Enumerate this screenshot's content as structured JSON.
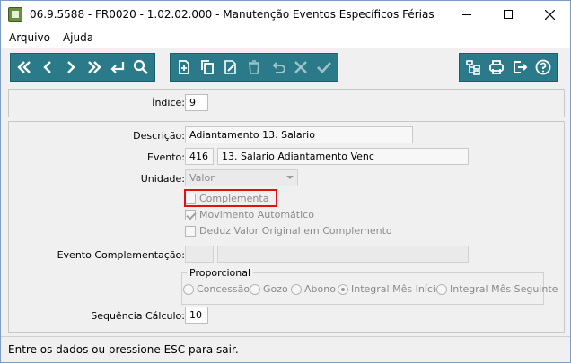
{
  "window": {
    "title": "06.9.5588 - FR0020 - 1.02.02.000 - Manutenção Eventos Específicos Férias"
  },
  "menubar": {
    "items": [
      "Arquivo",
      "Ajuda"
    ]
  },
  "toolbar": {
    "nav": [
      "first-icon",
      "prev-icon",
      "next-icon",
      "last-icon",
      "return-icon",
      "search-icon"
    ],
    "edit": [
      "new-icon",
      "copy-icon",
      "edit-icon",
      "delete-icon",
      "undo-icon",
      "cancel-icon",
      "confirm-icon"
    ],
    "util": [
      "tree-icon",
      "print-icon",
      "exit-icon",
      "help-icon"
    ]
  },
  "index": {
    "label": "Índice:",
    "value": "9"
  },
  "form": {
    "descricao": {
      "label": "Descrição:",
      "value": "Adiantamento 13. Salario"
    },
    "evento": {
      "label": "Evento:",
      "code": "416",
      "description": "13. Salario Adiantamento Venc"
    },
    "unidade": {
      "label": "Unidade:",
      "value": "Valor"
    },
    "complementa": {
      "label": "Complementa",
      "checked": false
    },
    "movimento": {
      "label": "Movimento Automático",
      "checked": true
    },
    "deduz": {
      "label": "Deduz Valor Original em Complemento",
      "checked": false
    },
    "evento_complementacao": {
      "label": "Evento Complementação:",
      "code": "",
      "description": ""
    },
    "proporcional": {
      "title": "Proporcional",
      "options": [
        "Concessão",
        "Gozo",
        "Abono",
        "Integral Mês Início",
        "Integral Mês Seguinte"
      ],
      "selected": "Integral Mês Início"
    },
    "sequencia": {
      "label": "Sequência Cálculo:",
      "value": "10"
    }
  },
  "status": {
    "text": "Entre os dados ou pressione ESC para sair."
  },
  "colors": {
    "toolbar_bg": "#2a7a8a",
    "highlight": "#e21010"
  }
}
